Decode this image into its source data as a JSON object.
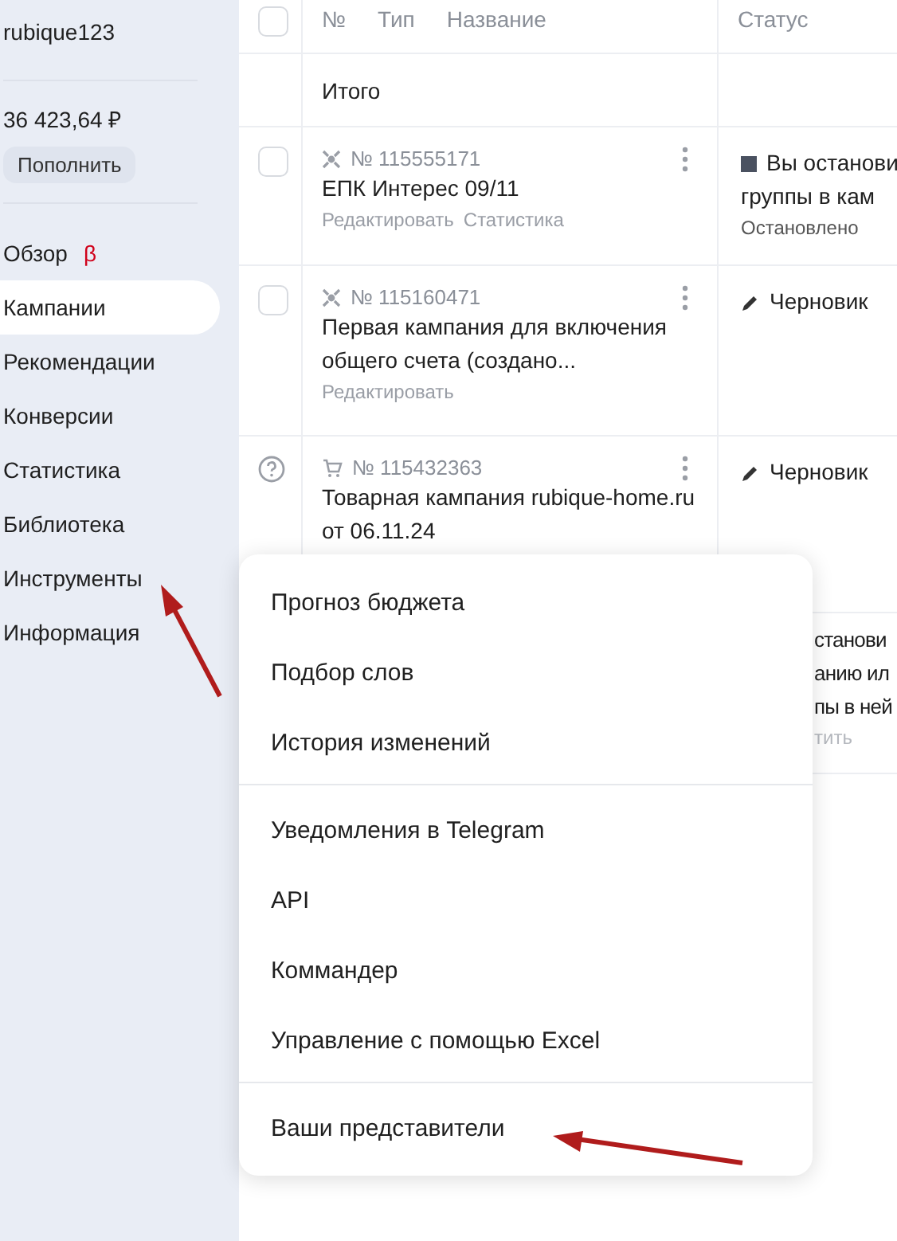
{
  "sidebar": {
    "username": "rubique123",
    "balance": "36 423,64 ₽",
    "topup_button": "Пополнить",
    "items": [
      {
        "label": "Обзор",
        "badge": "β",
        "selected": false
      },
      {
        "label": "Кампании",
        "selected": true
      },
      {
        "label": "Рекомендации",
        "selected": false
      },
      {
        "label": "Конверсии",
        "selected": false
      },
      {
        "label": "Статистика",
        "selected": false
      },
      {
        "label": "Библиотека",
        "selected": false
      },
      {
        "label": "Инструменты",
        "selected": false
      },
      {
        "label": "Информация",
        "selected": false
      }
    ]
  },
  "table": {
    "columns": [
      "№",
      "Тип",
      "Название",
      "Статус"
    ],
    "total_label": "Итого",
    "header_checked": false,
    "rows": [
      {
        "kind": "checkbox",
        "checked": false,
        "type": {
          "kind": "unified"
        },
        "number": "№ 115555171",
        "name": "ЕПК Интерес 09/11",
        "links": [
          "Редактировать",
          "Статистика"
        ],
        "status": {
          "kind": "stopped",
          "lines": [
            "Вы останови",
            "группы в кам"
          ],
          "note": "Остановлено"
        }
      },
      {
        "kind": "checkbox",
        "checked": false,
        "type": {
          "kind": "unified"
        },
        "number": "№ 115160471",
        "name": "Первая кампания для включения общего счета (создано...",
        "links": [
          "Редактировать"
        ],
        "status": {
          "kind": "draft",
          "lines": [
            "Черновик"
          ]
        }
      },
      {
        "kind": "help",
        "type": {
          "kind": "product"
        },
        "number": "№ 115432363",
        "name": "Товарная кампания rubique-home.ru от 06.11.24",
        "links": [],
        "status": {
          "kind": "draft",
          "lines": [
            "Черновик"
          ]
        }
      },
      {
        "kind": "hidden",
        "status": {
          "kind": "covered",
          "lines": [
            "станови",
            "анию ил",
            "пы в ней"
          ],
          "note": "тить"
        }
      }
    ]
  },
  "menu": {
    "groups": [
      [
        "Прогноз бюджета",
        "Подбор слов",
        "История изменений"
      ],
      [
        "Уведомления в Telegram",
        "API",
        "Коммандер",
        "Управление с помощью Excel"
      ],
      [
        "Ваши представители"
      ]
    ]
  }
}
